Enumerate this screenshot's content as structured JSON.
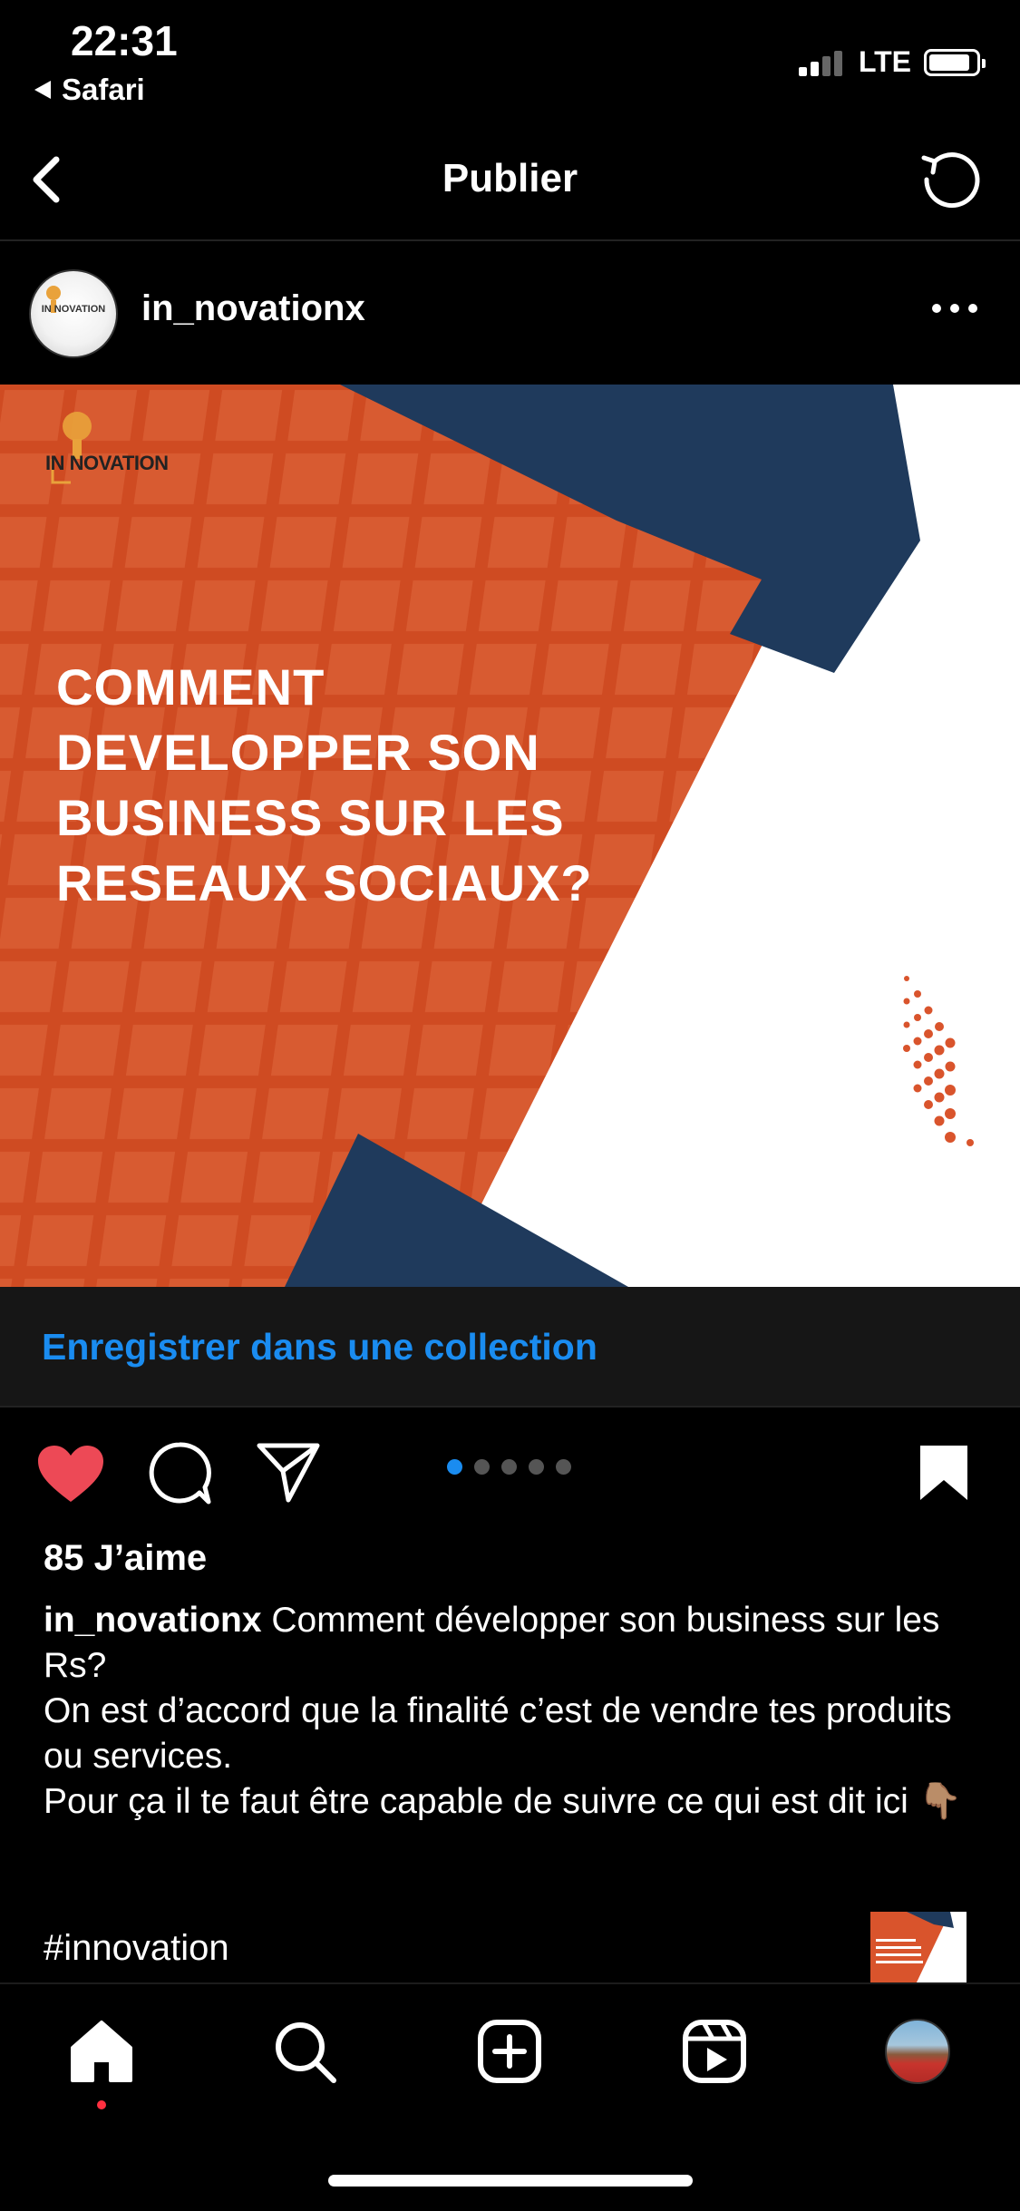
{
  "status_bar": {
    "time": "22:31",
    "back_app": "Safari",
    "network": "LTE"
  },
  "nav": {
    "title": "Publier"
  },
  "post": {
    "username": "in_novationx",
    "avatar_text": "IN NOVATION",
    "image": {
      "logo_text": "IN NOVATION",
      "headline": [
        "COMMENT",
        "DEVELOPPER SON",
        "BUSINESS SUR LES",
        "RESEAUX SOCIAUX?"
      ]
    },
    "save_to_collection": "Enregistrer dans une collection",
    "carousel": {
      "count": 5,
      "active_index": 0
    },
    "liked": true,
    "likes": "85 J’aime",
    "caption": {
      "username": "in_novationx",
      "text": "Comment développer son business sur les Rs?",
      "line2": "On est d’accord que la finalité c’est de vendre tes produits ou services.",
      "line3": "Pour ça il te faut être capable de suivre ce qui est dit ici 👇🏽"
    },
    "hashtag": "#innovation"
  },
  "tabbar": {
    "items": [
      "home-icon",
      "search-icon",
      "create-icon",
      "reels-icon",
      "profile-avatar"
    ],
    "active": "home-icon"
  },
  "colors": {
    "accent_blue": "#1a8cf0",
    "like_red": "#ed4956",
    "image_orange": "#d9542c",
    "image_navy": "#1f3a5c"
  }
}
